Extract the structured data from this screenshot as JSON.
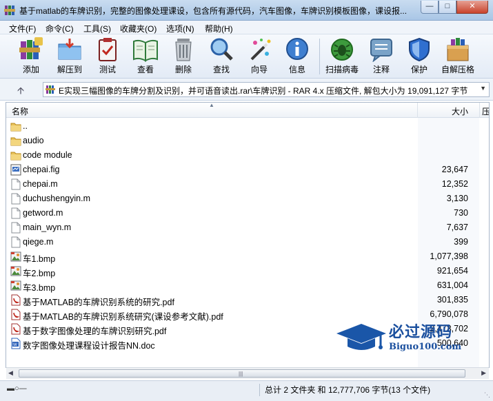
{
  "window": {
    "title": "基于matlab的车牌识别，完整的图像处理课设，包含所有源代码，汽车图像，车牌识别模板图像，课设报...",
    "minimize": "—",
    "maximize": "□",
    "close": "✕"
  },
  "menu": [
    "文件(F)",
    "命令(C)",
    "工具(S)",
    "收藏夹(O)",
    "选项(N)",
    "帮助(H)"
  ],
  "toolbar": {
    "add": "添加",
    "extract": "解压到",
    "test": "测试",
    "view": "查看",
    "delete": "删除",
    "find": "查找",
    "wizard": "向导",
    "info": "信息",
    "scan": "扫描病毒",
    "comment": "注释",
    "protect": "保护",
    "sfx": "自解压格"
  },
  "address": {
    "text": "E实现三幅图像的车牌分割及识别，并可语音读出.rar\\车牌识别 - RAR 4.x 压缩文件, 解包大小为 19,091,127 字节"
  },
  "columns": {
    "name": "名称",
    "size": "大小",
    "extra": "压"
  },
  "files": [
    {
      "name": "..",
      "size": "",
      "icon": "folder-up"
    },
    {
      "name": "audio",
      "size": "",
      "icon": "folder"
    },
    {
      "name": "code module",
      "size": "",
      "icon": "folder"
    },
    {
      "name": "chepai.fig",
      "size": "23,647",
      "icon": "fig"
    },
    {
      "name": "chepai.m",
      "size": "12,352",
      "icon": "file"
    },
    {
      "name": "duchushengyin.m",
      "size": "3,130",
      "icon": "file"
    },
    {
      "name": "getword.m",
      "size": "730",
      "icon": "file"
    },
    {
      "name": "main_wyn.m",
      "size": "7,637",
      "icon": "file"
    },
    {
      "name": "qiege.m",
      "size": "399",
      "icon": "file"
    },
    {
      "name": "车1.bmp",
      "size": "1,077,398",
      "icon": "bmp"
    },
    {
      "name": "车2.bmp",
      "size": "921,654",
      "icon": "bmp"
    },
    {
      "name": "车3.bmp",
      "size": "631,004",
      "icon": "bmp"
    },
    {
      "name": "基于MATLAB的车牌识别系统的研究.pdf",
      "size": "301,835",
      "icon": "pdf"
    },
    {
      "name": "基于MATLAB的车牌识别系统研究(课设参考文献).pdf",
      "size": "6,790,078",
      "icon": "pdf"
    },
    {
      "name": "基于数字图像处理的车牌识别研究.pdf",
      "size": "2,473,702",
      "icon": "pdf"
    },
    {
      "name": "数字图像处理课程设计报告NN.doc",
      "size": "500,640",
      "icon": "doc"
    }
  ],
  "watermark": {
    "title": "必过源码",
    "url": "Biguo100.com"
  },
  "status": {
    "text": "总计 2 文件夹 和 12,777,706 字节(13 个文件)"
  }
}
